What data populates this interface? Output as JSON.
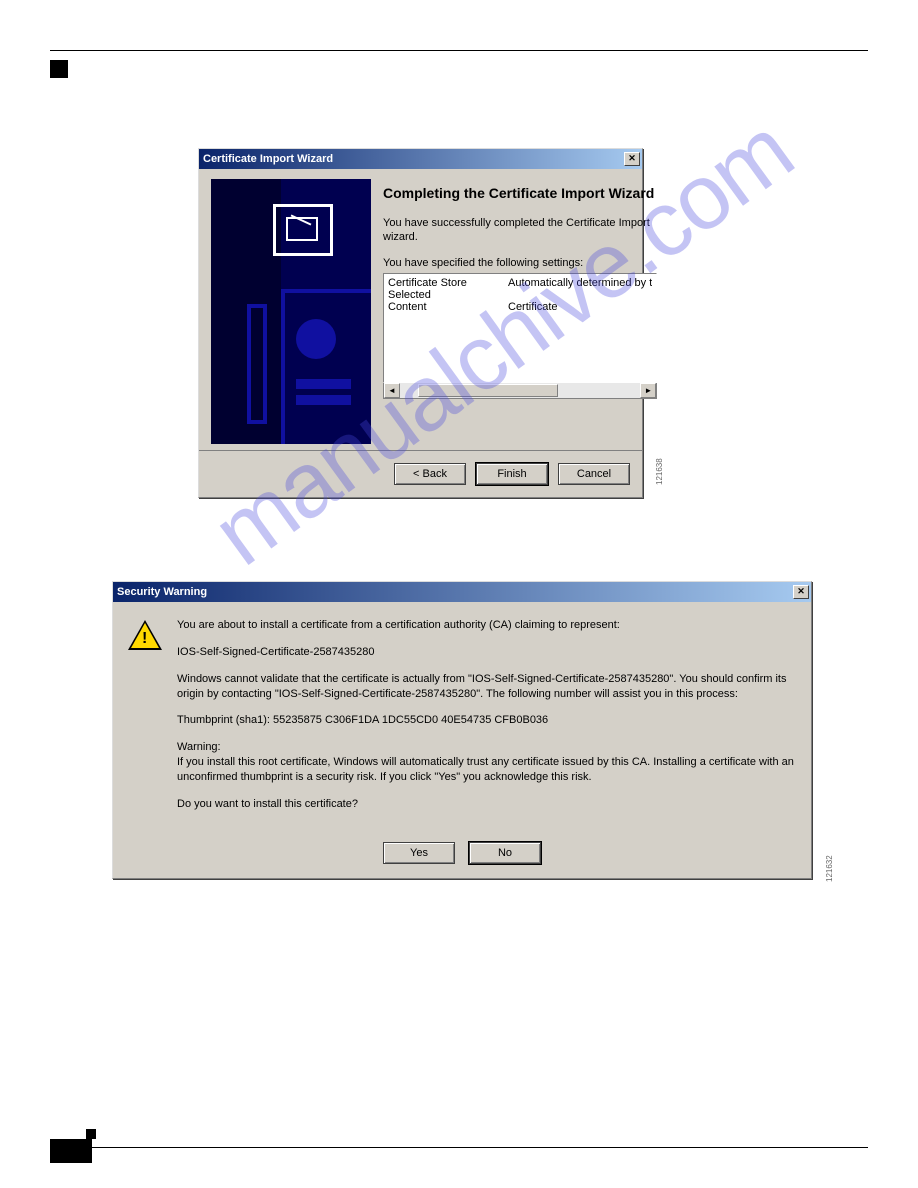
{
  "wizard": {
    "title": "Certificate Import Wizard",
    "heading": "Completing the Certificate Import Wizard",
    "success_text": "You have successfully completed the Certificate Import wizard.",
    "settings_label": "You have specified the following settings:",
    "settings": [
      {
        "key": "Certificate Store Selected",
        "value": "Automatically determined by t"
      },
      {
        "key": "Content",
        "value": "Certificate"
      }
    ],
    "buttons": {
      "back": "< Back",
      "finish": "Finish",
      "cancel": "Cancel"
    },
    "figure_id": "121638"
  },
  "warning": {
    "title": "Security Warning",
    "line_intro": "You are about to install a certificate from a certification authority (CA) claiming to represent:",
    "cert_name": "IOS-Self-Signed-Certificate-2587435280",
    "validate_text": "Windows cannot validate that the certificate is actually from \"IOS-Self-Signed-Certificate-2587435280\". You should confirm its origin by contacting \"IOS-Self-Signed-Certificate-2587435280\". The following number will assist you in this process:",
    "thumbprint": "Thumbprint (sha1): 55235875 C306F1DA 1DC55CD0 40E54735 CFB0B036",
    "warning_label": "Warning:",
    "warning_text": "If you install this root certificate, Windows will automatically trust any certificate issued by this CA. Installing a certificate with an unconfirmed thumbprint is a security risk. If you click \"Yes\" you acknowledge this risk.",
    "question": "Do you want to install this certificate?",
    "buttons": {
      "yes": "Yes",
      "no": "No"
    },
    "figure_id": "121632"
  },
  "watermark": "manualchive.com"
}
